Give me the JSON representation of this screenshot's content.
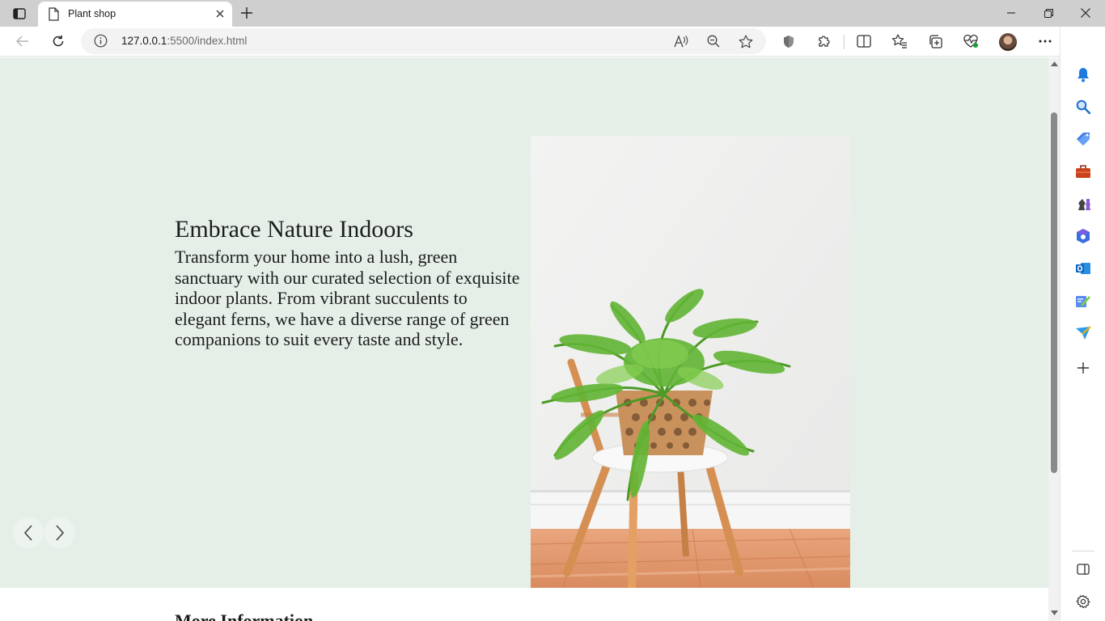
{
  "browser": {
    "tab_title": "Plant shop",
    "url_host": "127.0.0.1",
    "url_path": ":5500/index.html"
  },
  "page": {
    "hero_heading": "Embrace Nature Indoors",
    "hero_body": "Transform your home into a lush, green sanctuary with our curated selection of exquisite indoor plants. From vibrant succulents to elegant ferns, we have a diverse range of green companions to suit every taste and style.",
    "more_info_heading": "More Information",
    "hero_bg": "#e5efe7"
  },
  "icons": {
    "tab": [
      "tab-actions-icon",
      "page-icon",
      "close-icon",
      "plus-icon"
    ],
    "window": [
      "minimize-icon",
      "restore-icon",
      "close-icon"
    ],
    "toolbar": [
      "back-arrow-icon",
      "refresh-icon",
      "info-icon",
      "read-aloud-icon",
      "zoom-out-icon",
      "star-icon",
      "shield-icon",
      "extensions-icon",
      "split-screen-icon",
      "favorites-icon",
      "collections-icon",
      "heart-pulse-icon",
      "more-icon",
      "bing-icon"
    ],
    "carousel": [
      "chevron-left-icon",
      "chevron-right-icon"
    ],
    "sidebar": [
      "bell-icon",
      "search-icon",
      "tag-icon",
      "briefcase-icon",
      "chess-icon",
      "office-icon",
      "outlook-icon",
      "drawing-icon",
      "send-icon",
      "plus-icon",
      "sidebar-panel-icon",
      "gear-icon"
    ]
  }
}
